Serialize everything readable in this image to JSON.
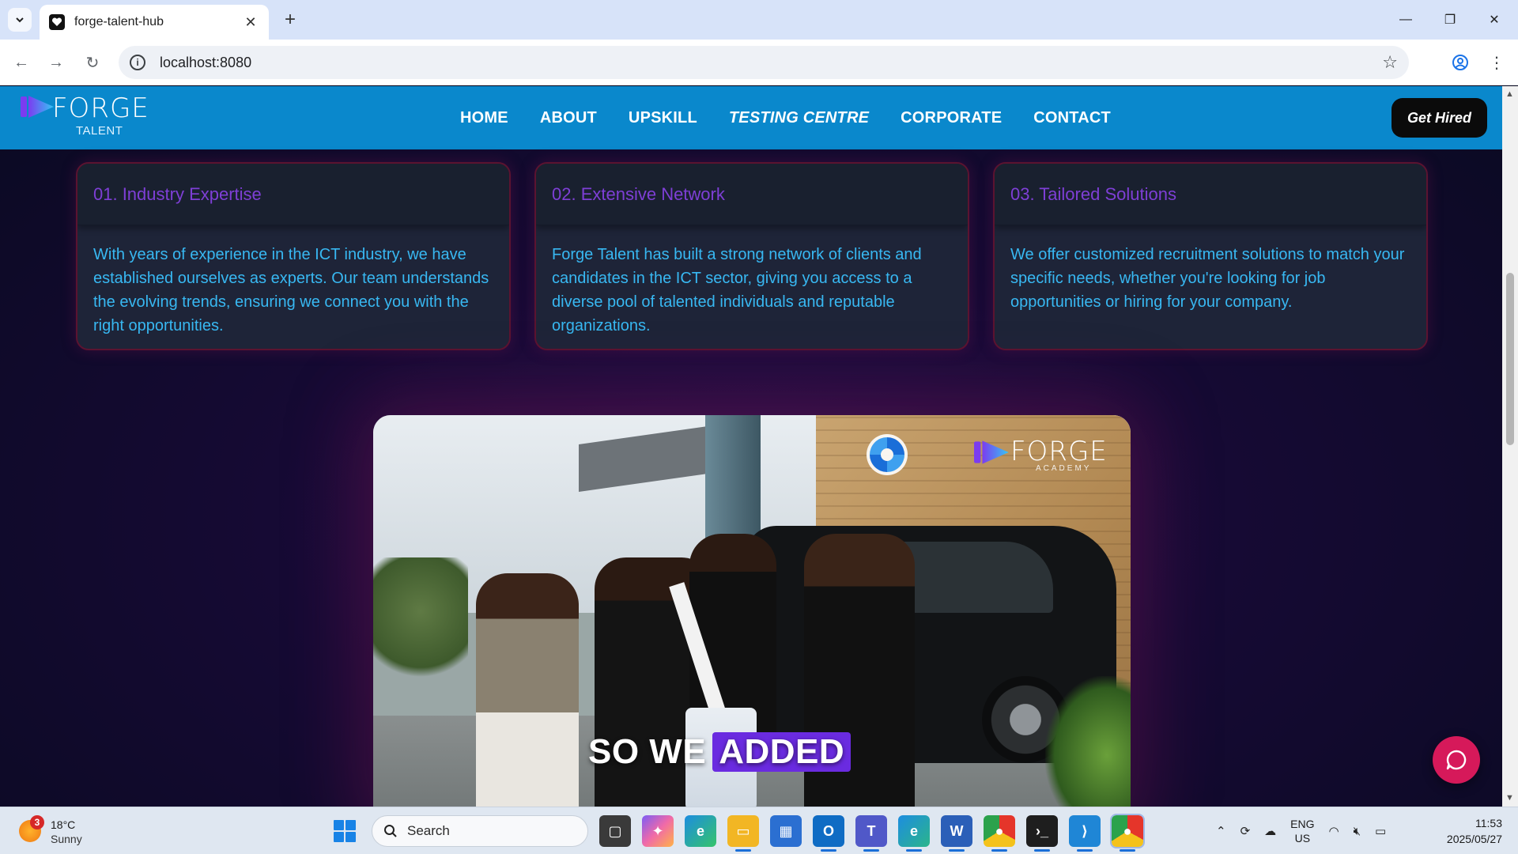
{
  "browser": {
    "tab_title": "forge-talent-hub",
    "url": "localhost:8080"
  },
  "header": {
    "logo_text": "FORGE",
    "logo_sub": "TALENT",
    "nav": [
      {
        "label": "HOME",
        "active": false
      },
      {
        "label": "ABOUT",
        "active": false
      },
      {
        "label": "UPSKILL",
        "active": false
      },
      {
        "label": "TESTING CENTRE",
        "active": true
      },
      {
        "label": "CORPORATE",
        "active": false
      },
      {
        "label": "CONTACT",
        "active": false
      }
    ],
    "cta_label": "Get Hired"
  },
  "cards": [
    {
      "title": "01. Industry Expertise",
      "body": "With years of experience in the ICT industry, we have established ourselves as experts. Our team understands the evolving trends, ensuring we connect you with the right opportunities."
    },
    {
      "title": "02. Extensive Network",
      "body": "Forge Talent has built a strong network of clients and candidates in the ICT sector, giving you access to a diverse pool of talented individuals and reputable organizations."
    },
    {
      "title": "03. Tailored Solutions",
      "body": "We offer customized recruitment solutions to match your specific needs, whether you're looking for job opportunities or hiring for your company."
    }
  ],
  "video": {
    "caption_pre": "SO WE",
    "caption_highlight": "ADDED",
    "overlay_logo_text": "FORGE",
    "overlay_logo_sub": "ACADEMY"
  },
  "taskbar": {
    "weather_temp": "18°C",
    "weather_cond": "Sunny",
    "weather_badge": "3",
    "search_label": "Search",
    "lang_top": "ENG",
    "lang_bottom": "US",
    "time": "11:53",
    "date": "2025/05/27"
  },
  "colors": {
    "header_bg": "#0a88cc",
    "card_title": "#7e3fd6",
    "card_text": "#38b8f2",
    "chat_fab": "#d6195a",
    "caption_highlight": "#6a2be0"
  }
}
